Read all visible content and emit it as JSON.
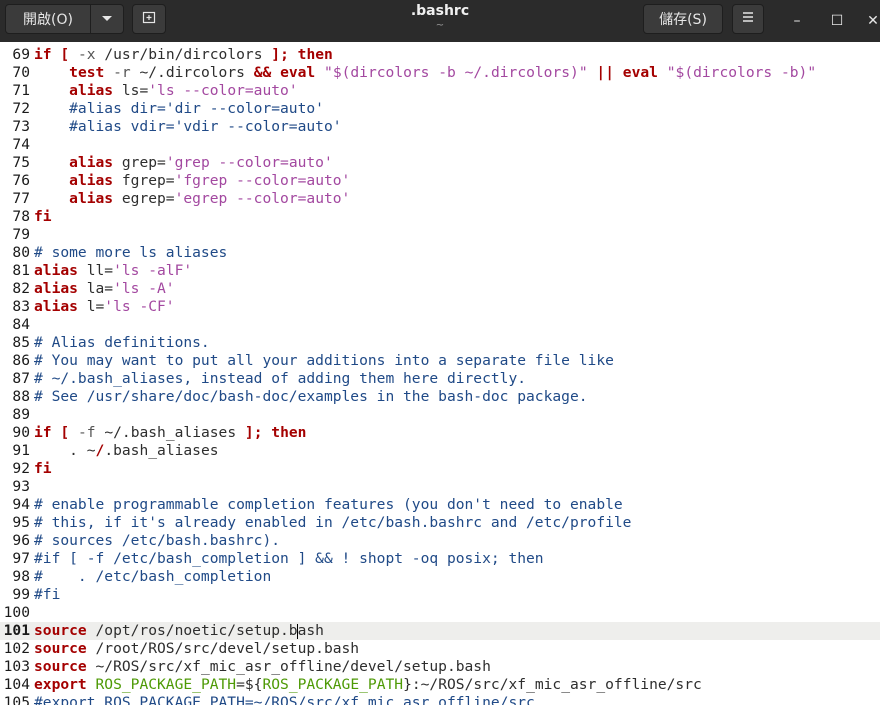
{
  "header": {
    "open_label": "開啟(O)",
    "open_menu_icon": "chevron-down-icon",
    "new_tab_icon": "new-tab-icon",
    "title": ".bashrc",
    "subtitle": "~",
    "save_label": "儲存(S)",
    "menu_icon": "hamburger-menu-icon",
    "minimize": "–",
    "maximize": "☐",
    "close": "✕"
  },
  "editor": {
    "current_line": 101,
    "lines": [
      {
        "n": "69",
        "segs": [
          [
            "kw",
            "if"
          ],
          [
            "",
            "&nbsp;"
          ],
          [
            "kw",
            "["
          ],
          [
            "",
            "&nbsp;"
          ],
          [
            "opt",
            "-x"
          ],
          [
            "",
            "&nbsp;/usr/bin/dircolors&nbsp;"
          ],
          [
            "kw",
            "];"
          ],
          [
            "",
            "&nbsp;"
          ],
          [
            "kw",
            "then"
          ]
        ]
      },
      {
        "n": "70",
        "segs": [
          [
            "",
            "&nbsp;&nbsp;&nbsp;&nbsp;"
          ],
          [
            "cmd",
            "test"
          ],
          [
            "",
            "&nbsp;"
          ],
          [
            "opt",
            "-r"
          ],
          [
            "",
            "&nbsp;~/.dircolors&nbsp;"
          ],
          [
            "kw",
            "&amp;&amp;"
          ],
          [
            "",
            "&nbsp;"
          ],
          [
            "cmd",
            "eval"
          ],
          [
            "",
            "&nbsp;"
          ],
          [
            "str",
            "\"$(dircolors -b ~/.dircolors)\""
          ],
          [
            "",
            "&nbsp;"
          ],
          [
            "kw",
            "||"
          ],
          [
            "",
            "&nbsp;"
          ],
          [
            "cmd",
            "eval"
          ],
          [
            "",
            "&nbsp;"
          ],
          [
            "str",
            "\"$(dircolors -b)\""
          ]
        ]
      }
    ]
  }
}
